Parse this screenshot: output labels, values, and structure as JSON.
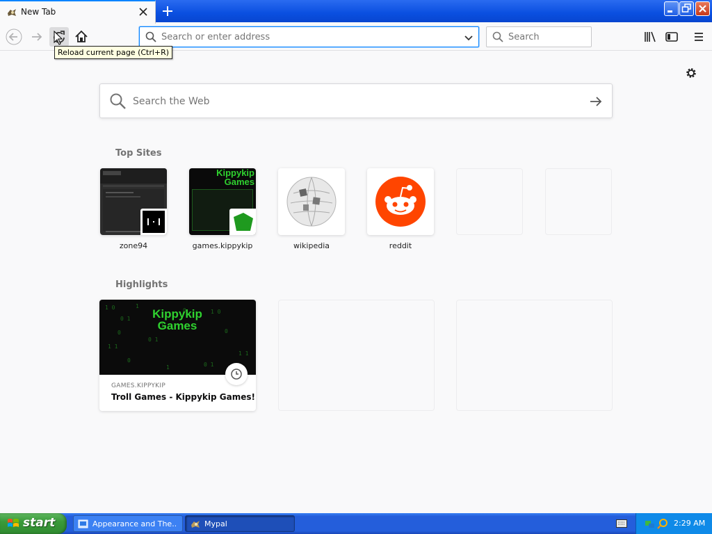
{
  "browser": {
    "tab": {
      "title": "New Tab"
    },
    "toolbar": {
      "url_placeholder": "Search or enter address",
      "search_placeholder": "Search",
      "tooltip": "Reload current page (Ctrl+R)"
    }
  },
  "newtab": {
    "search_placeholder": "Search the Web",
    "top_sites_title": "Top Sites",
    "top_sites": [
      {
        "label": "zone94"
      },
      {
        "label": "games.kippykip"
      },
      {
        "label": "wikipedia"
      },
      {
        "label": "reddit"
      }
    ],
    "highlights_title": "Highlights",
    "highlights": [
      {
        "context": "GAMES.KIPPYKIP",
        "title": "Troll Games - Kippykip Games!",
        "image_text": "Kippykip Games"
      }
    ],
    "kippykip_thumb_text": "Kippykip Games"
  },
  "taskbar": {
    "start_label": "start",
    "tasks": [
      {
        "label": "Appearance and The..."
      },
      {
        "label": "Mypal"
      }
    ],
    "clock": "2:29 AM"
  },
  "colors": {
    "accent": "#0a84ff",
    "reddit": "#ff4500",
    "kippykip_green": "#2fd12f"
  }
}
